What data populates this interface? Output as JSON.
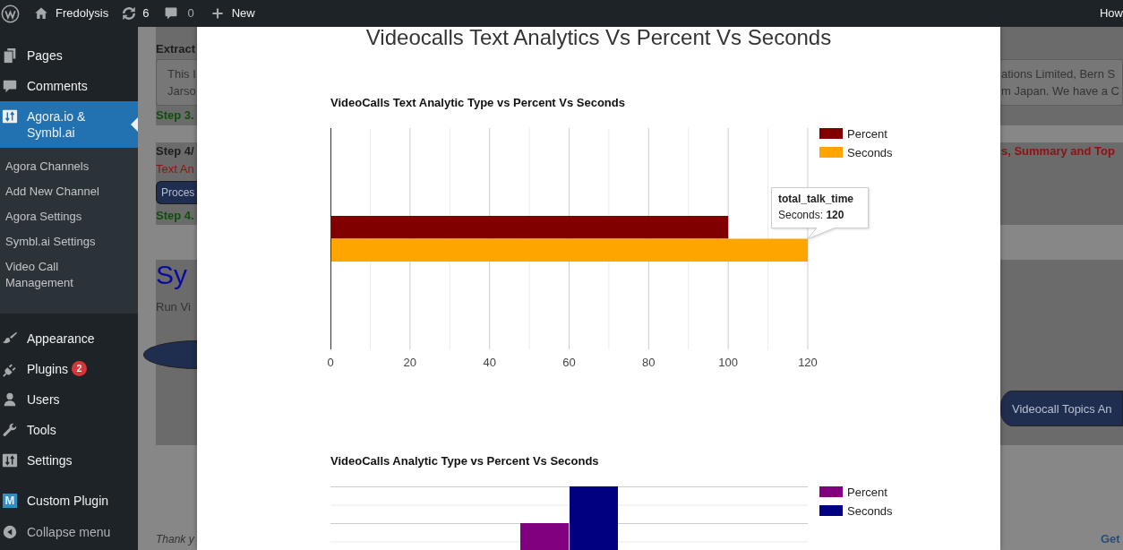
{
  "admin_bar": {
    "site_name": "Fredolysis",
    "updates_count": "6",
    "comments_count": "0",
    "new_label": "New",
    "account_label": "How"
  },
  "sidebar": {
    "groups": [
      {
        "items": [
          {
            "label": "Pages",
            "selected": false
          },
          {
            "label": "Comments",
            "selected": false
          },
          {
            "label": "Agora.io & Symbl.ai",
            "selected": true,
            "children": [
              {
                "label": "Agora Channels",
                "selected": false
              },
              {
                "label": "Add New Channel",
                "selected": false
              },
              {
                "label": "Agora Settings",
                "selected": false
              },
              {
                "label": "Symbl.ai Settings",
                "selected": false
              },
              {
                "label": "Video Call Management",
                "selected": false
              }
            ]
          }
        ]
      },
      {
        "items": [
          {
            "label": "Appearance",
            "selected": false
          },
          {
            "label": "Plugins",
            "selected": false,
            "badge": "2"
          },
          {
            "label": "Users",
            "selected": false
          },
          {
            "label": "Tools",
            "selected": false
          },
          {
            "label": "Settings",
            "selected": false
          }
        ]
      },
      {
        "items": [
          {
            "label": "Custom Plugin",
            "selected": false,
            "icon_glyph": "M"
          }
        ]
      }
    ],
    "collapse_label": "Collapse menu"
  },
  "page_behind": {
    "left": {
      "extract_heading": "Extract",
      "transcript_lines": [
        "This I",
        "Jarso"
      ],
      "step_3_note": "Step 3.",
      "step_4_heading": "Step 4/",
      "text_analytics_label": "Text An",
      "process_button": "Proces",
      "step_4_note": "Step 4.",
      "section_title": "Sy",
      "intro": "Run Vi",
      "footer": "Thank y"
    },
    "right": {
      "transcript_lines": [
        "ations Limited, Bern S",
        "m Japan. We have a C"
      ],
      "step_4_heading": "s, Summary and Top",
      "topics_button": "Videocall Topics An",
      "footer_link": "Get"
    }
  },
  "modal": {
    "title": "Videocalls Text Analytics Vs Percent Vs Seconds",
    "charts": [
      {
        "chart_data": {
          "type": "bar",
          "orientation": "horizontal",
          "title": "VideoCalls Text Analytic Type vs Percent Vs Seconds",
          "series": [
            {
              "name": "Percent",
              "color": "#800000",
              "values": [
                100
              ]
            },
            {
              "name": "Seconds",
              "color": "#ffa500",
              "values": [
                120
              ]
            }
          ],
          "xlim": [
            0,
            120
          ],
          "xticks": [
            {
              "value": 0,
              "label": "0"
            },
            20,
            40,
            60,
            80,
            100,
            120
          ],
          "grid": true,
          "legend": true
        },
        "tooltip": {
          "title": "total_talk_time",
          "text": "Seconds: **120**"
        }
      },
      {
        "title": "VideoCalls Analytic Type vs Percent Vs Seconds",
        "legend": [
          {
            "label": "Percent",
            "color": "#800080"
          },
          {
            "label": "Seconds",
            "color": "#000080"
          }
        ]
      }
    ]
  }
}
